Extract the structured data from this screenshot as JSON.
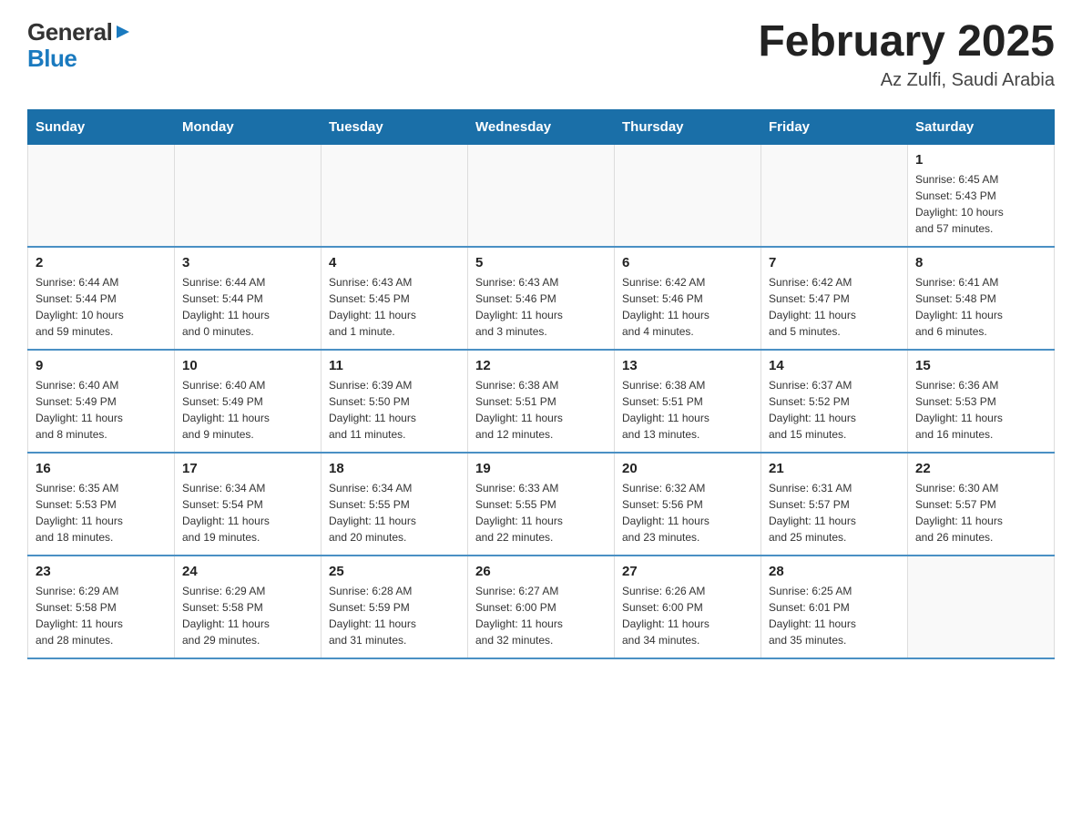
{
  "header": {
    "logo_general": "General",
    "logo_blue": "Blue",
    "month_title": "February 2025",
    "location": "Az Zulfi, Saudi Arabia"
  },
  "days_of_week": [
    "Sunday",
    "Monday",
    "Tuesday",
    "Wednesday",
    "Thursday",
    "Friday",
    "Saturday"
  ],
  "weeks": [
    [
      {
        "day": "",
        "info": ""
      },
      {
        "day": "",
        "info": ""
      },
      {
        "day": "",
        "info": ""
      },
      {
        "day": "",
        "info": ""
      },
      {
        "day": "",
        "info": ""
      },
      {
        "day": "",
        "info": ""
      },
      {
        "day": "1",
        "info": "Sunrise: 6:45 AM\nSunset: 5:43 PM\nDaylight: 10 hours\nand 57 minutes."
      }
    ],
    [
      {
        "day": "2",
        "info": "Sunrise: 6:44 AM\nSunset: 5:44 PM\nDaylight: 10 hours\nand 59 minutes."
      },
      {
        "day": "3",
        "info": "Sunrise: 6:44 AM\nSunset: 5:44 PM\nDaylight: 11 hours\nand 0 minutes."
      },
      {
        "day": "4",
        "info": "Sunrise: 6:43 AM\nSunset: 5:45 PM\nDaylight: 11 hours\nand 1 minute."
      },
      {
        "day": "5",
        "info": "Sunrise: 6:43 AM\nSunset: 5:46 PM\nDaylight: 11 hours\nand 3 minutes."
      },
      {
        "day": "6",
        "info": "Sunrise: 6:42 AM\nSunset: 5:46 PM\nDaylight: 11 hours\nand 4 minutes."
      },
      {
        "day": "7",
        "info": "Sunrise: 6:42 AM\nSunset: 5:47 PM\nDaylight: 11 hours\nand 5 minutes."
      },
      {
        "day": "8",
        "info": "Sunrise: 6:41 AM\nSunset: 5:48 PM\nDaylight: 11 hours\nand 6 minutes."
      }
    ],
    [
      {
        "day": "9",
        "info": "Sunrise: 6:40 AM\nSunset: 5:49 PM\nDaylight: 11 hours\nand 8 minutes."
      },
      {
        "day": "10",
        "info": "Sunrise: 6:40 AM\nSunset: 5:49 PM\nDaylight: 11 hours\nand 9 minutes."
      },
      {
        "day": "11",
        "info": "Sunrise: 6:39 AM\nSunset: 5:50 PM\nDaylight: 11 hours\nand 11 minutes."
      },
      {
        "day": "12",
        "info": "Sunrise: 6:38 AM\nSunset: 5:51 PM\nDaylight: 11 hours\nand 12 minutes."
      },
      {
        "day": "13",
        "info": "Sunrise: 6:38 AM\nSunset: 5:51 PM\nDaylight: 11 hours\nand 13 minutes."
      },
      {
        "day": "14",
        "info": "Sunrise: 6:37 AM\nSunset: 5:52 PM\nDaylight: 11 hours\nand 15 minutes."
      },
      {
        "day": "15",
        "info": "Sunrise: 6:36 AM\nSunset: 5:53 PM\nDaylight: 11 hours\nand 16 minutes."
      }
    ],
    [
      {
        "day": "16",
        "info": "Sunrise: 6:35 AM\nSunset: 5:53 PM\nDaylight: 11 hours\nand 18 minutes."
      },
      {
        "day": "17",
        "info": "Sunrise: 6:34 AM\nSunset: 5:54 PM\nDaylight: 11 hours\nand 19 minutes."
      },
      {
        "day": "18",
        "info": "Sunrise: 6:34 AM\nSunset: 5:55 PM\nDaylight: 11 hours\nand 20 minutes."
      },
      {
        "day": "19",
        "info": "Sunrise: 6:33 AM\nSunset: 5:55 PM\nDaylight: 11 hours\nand 22 minutes."
      },
      {
        "day": "20",
        "info": "Sunrise: 6:32 AM\nSunset: 5:56 PM\nDaylight: 11 hours\nand 23 minutes."
      },
      {
        "day": "21",
        "info": "Sunrise: 6:31 AM\nSunset: 5:57 PM\nDaylight: 11 hours\nand 25 minutes."
      },
      {
        "day": "22",
        "info": "Sunrise: 6:30 AM\nSunset: 5:57 PM\nDaylight: 11 hours\nand 26 minutes."
      }
    ],
    [
      {
        "day": "23",
        "info": "Sunrise: 6:29 AM\nSunset: 5:58 PM\nDaylight: 11 hours\nand 28 minutes."
      },
      {
        "day": "24",
        "info": "Sunrise: 6:29 AM\nSunset: 5:58 PM\nDaylight: 11 hours\nand 29 minutes."
      },
      {
        "day": "25",
        "info": "Sunrise: 6:28 AM\nSunset: 5:59 PM\nDaylight: 11 hours\nand 31 minutes."
      },
      {
        "day": "26",
        "info": "Sunrise: 6:27 AM\nSunset: 6:00 PM\nDaylight: 11 hours\nand 32 minutes."
      },
      {
        "day": "27",
        "info": "Sunrise: 6:26 AM\nSunset: 6:00 PM\nDaylight: 11 hours\nand 34 minutes."
      },
      {
        "day": "28",
        "info": "Sunrise: 6:25 AM\nSunset: 6:01 PM\nDaylight: 11 hours\nand 35 minutes."
      },
      {
        "day": "",
        "info": ""
      }
    ]
  ]
}
